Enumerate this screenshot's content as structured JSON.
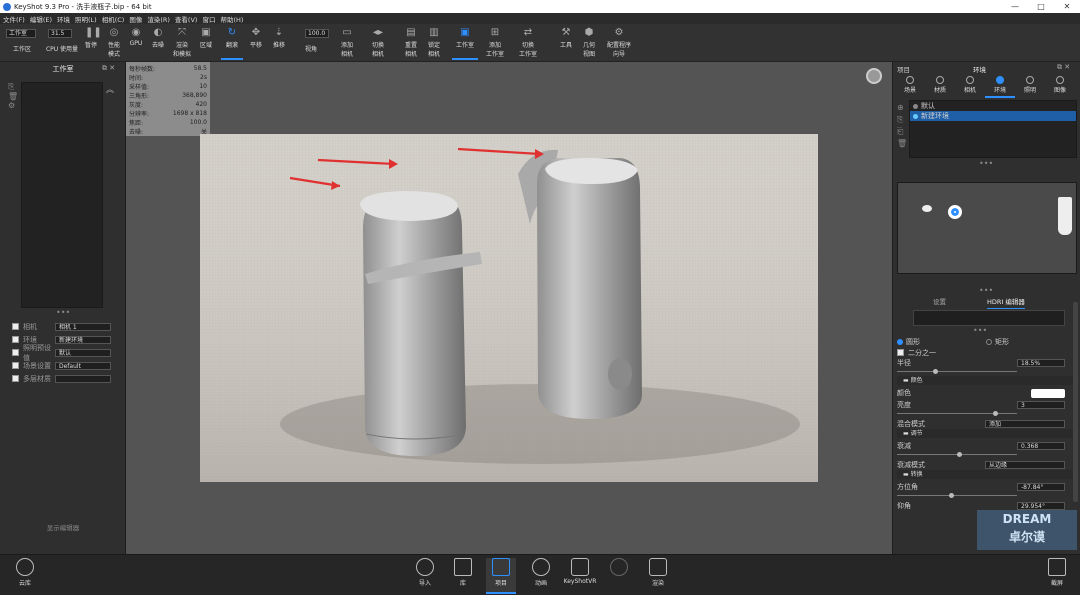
{
  "app": {
    "title": "KeyShot 9.3 Pro - 洗手液瓶子.bip - 64 bit",
    "window_controls": [
      "—",
      "□",
      "✕"
    ]
  },
  "menu": [
    "文件(F)",
    "编辑(E)",
    "环境",
    "照明(L)",
    "相机(C)",
    "图像",
    "渲染(R)",
    "查看(V)",
    "窗口",
    "帮助(H)"
  ],
  "toolbar": {
    "workspace_select": "工作室",
    "workspace_label": "工作区",
    "cpu_value": "31.5",
    "cpu_label": "CPU 使用量",
    "pause_label": "暂停",
    "perf_label": "性能\n模式",
    "gpu_label": "GPU",
    "denoise_label": "去噪",
    "render_label": "渲染\n和模拟",
    "region_label": "区域",
    "tumble_label": "翻滚",
    "pan_label": "平移",
    "dolly_label": "推移",
    "fov_value": "100.0",
    "fov_label": "视角",
    "add_camera_label": "添加\n相机",
    "switch_camera_label": "切换\n相机",
    "reset_camera_label": "重置\n相机",
    "lock_camera_label": "锁定\n相机",
    "studio_label": "工作室",
    "add_studio_label": "添加\n工作室",
    "switch_studio_label": "切换\n工作室",
    "tools_label": "工具",
    "geometry_label": "几何\n视图",
    "config_label": "配置程序\n向导"
  },
  "left_panel": {
    "title": "工作室",
    "rows": [
      {
        "label": "相机",
        "value": "相机 1"
      },
      {
        "label": "环境",
        "value": "新建环境"
      },
      {
        "label": "照明预设值",
        "value": "默认"
      },
      {
        "label": "场景设置",
        "value": "Default"
      },
      {
        "label": "多层材质",
        "value": ""
      }
    ],
    "footer": "显示编辑器"
  },
  "hud": {
    "rows": [
      {
        "label": "每秒帧数:",
        "value": "58.5"
      },
      {
        "label": "时间:",
        "value": "2s"
      },
      {
        "label": "采样值:",
        "value": "10"
      },
      {
        "label": "三角形:",
        "value": "368,890"
      },
      {
        "label": "灰度:",
        "value": "420"
      },
      {
        "label": "分辨率:",
        "value": "1698 x 818"
      },
      {
        "label": "焦距:",
        "value": "100.0"
      },
      {
        "label": "去噪:",
        "value": "关"
      }
    ]
  },
  "right_panel": {
    "header_left": "项目",
    "header_title": "环境",
    "tabs": [
      "场景",
      "材质",
      "相机",
      "环境",
      "照明",
      "图像"
    ],
    "env_list": [
      "默认",
      "新建环境"
    ],
    "subtabs": [
      "设置",
      "HDRI 编辑器"
    ],
    "shape_options": [
      "圆形",
      "矩形"
    ],
    "half_label": "二分之一",
    "radius_label": "半径",
    "radius_value": "18.5%",
    "color_section": "颜色",
    "color_label": "颜色",
    "brightness_label": "亮度",
    "brightness_value": "3",
    "blend_label": "混合模式",
    "blend_value": "添加",
    "adjust_section": "调节",
    "falloff_label": "衰减",
    "falloff_value": "0.368",
    "falloff_mode_label": "衰减模式",
    "falloff_mode_value": "从边缘",
    "transform_section": "转换",
    "azimuth_label": "方位角",
    "azimuth_value": "-87.84°",
    "elevation_label": "仰角",
    "elevation_value": "29.954°"
  },
  "bottom": {
    "cloud_label": "云库",
    "import_label": "导入",
    "library_label": "库",
    "project_label": "项目",
    "animation_label": "动画",
    "vr_label": "KeyShotVR",
    "render_label": "渲染",
    "screenshot_label": "截屏"
  },
  "watermark": {
    "line1": "DREAM",
    "line2": "卓尔谟"
  },
  "colors": {
    "accent": "#2e8fff",
    "arrow": "#e03030"
  }
}
